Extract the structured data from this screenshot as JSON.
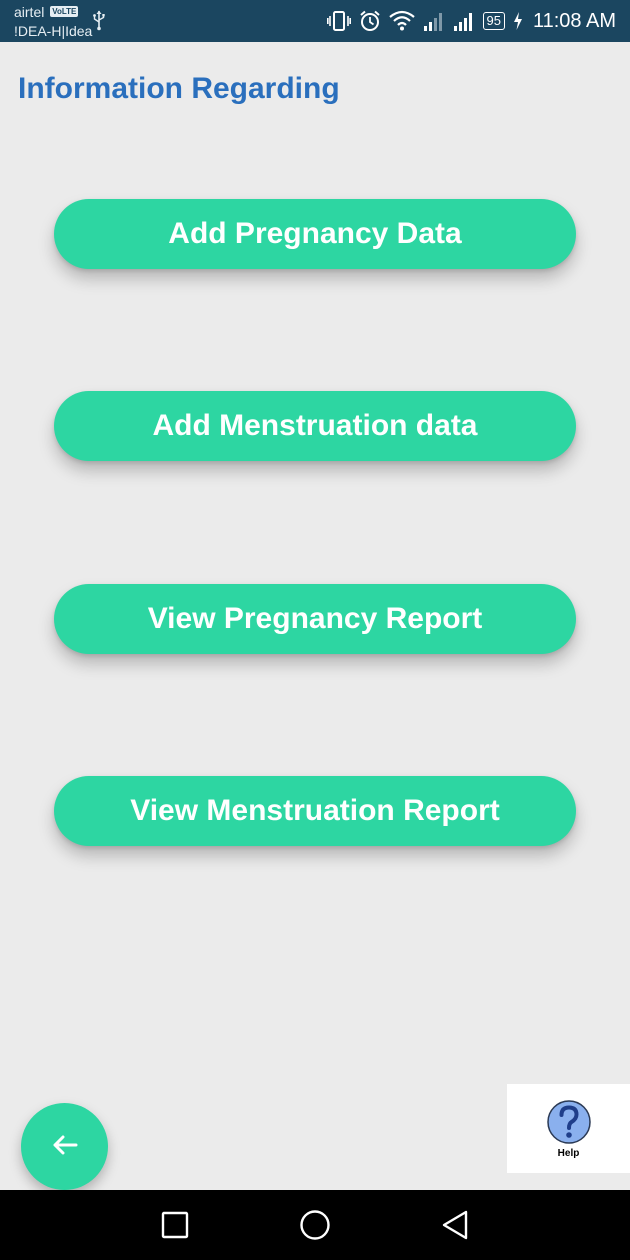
{
  "status_bar": {
    "carrier_primary": "airtel",
    "volte_badge": "VoLTE",
    "carrier_secondary": "!DEA-H|Idea",
    "battery_level": "95",
    "time": "11:08 AM",
    "icons": [
      "usb-icon",
      "vibrate-icon",
      "alarm-icon",
      "wifi-icon",
      "signal-weak-icon",
      "signal-icon",
      "battery-icon",
      "charging-icon"
    ]
  },
  "page": {
    "title": "Information Regarding"
  },
  "menu": {
    "add_pregnancy": "Add Pregnancy Data",
    "add_menstruation": "Add Menstruation data",
    "view_pregnancy": "View Pregnancy Report",
    "view_menstruation": "View Menstruation Report"
  },
  "fab": {
    "icon": "arrow-left-icon"
  },
  "help": {
    "label": "Help",
    "icon": "question-icon"
  },
  "nav_bar": {
    "icons": [
      "recent-apps-icon",
      "home-icon",
      "back-icon"
    ]
  },
  "colors": {
    "status_bar": "#1b4660",
    "background": "#ebebeb",
    "title": "#2a6fbd",
    "button": "#2dd6a2",
    "help_circle": "#8ab0ee"
  }
}
